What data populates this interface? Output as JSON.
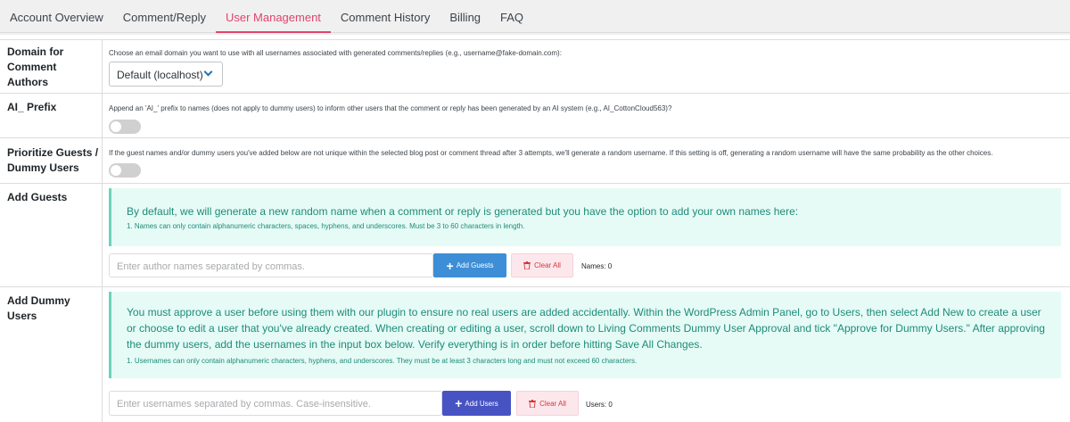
{
  "tabs": [
    {
      "label": "Account Overview",
      "active": false
    },
    {
      "label": "Comment/Reply",
      "active": false
    },
    {
      "label": "User Management",
      "active": true
    },
    {
      "label": "Comment History",
      "active": false
    },
    {
      "label": "Billing",
      "active": false
    },
    {
      "label": "FAQ",
      "active": false
    }
  ],
  "domain": {
    "label": "Domain for Comment Authors",
    "description": "Choose an email domain you want to use with all usernames associated with generated comments/replies (e.g., username@fake-domain.com):",
    "selected": "Default (localhost)"
  },
  "ai_prefix": {
    "label": "AI_ Prefix",
    "description": "Append an 'AI_' prefix to names (does not apply to dummy users) to inform other users that the comment or reply has been generated by an AI system (e.g., AI_CottonCloud563)?",
    "enabled": false
  },
  "prioritize": {
    "label": "Prioritize Guests / Dummy Users",
    "description": "If the guest names and/or dummy users you've added below are not unique within the selected blog post or comment thread after 3 attempts, we'll generate a random username. If this setting is off, generating a random username will have the same probability as the other choices.",
    "enabled": false
  },
  "guests": {
    "label": "Add Guests",
    "notice": "By default, we will generate a new random name when a comment or reply is generated but you have the option to add your own names here:",
    "note": "1. Names can only contain alphanumeric characters, spaces, hyphens, and underscores. Must be 3 to 60 characters in length.",
    "placeholder": "Enter author names separated by commas.",
    "add_label": "Add Guests",
    "clear_label": "Clear All",
    "count_text": "Names: 0"
  },
  "dummy": {
    "label": "Add Dummy Users",
    "notice": "You must approve a user before using them with our plugin to ensure no real users are added accidentally. Within the WordPress Admin Panel, go to Users, then select Add New to create a user or choose to edit a user that you've already created. When creating or editing a user, scroll down to Living Comments Dummy User Approval and tick \"Approve for Dummy Users.\" After approving the dummy users, add the usernames in the input box below. Verify everything is in order before hitting Save All Changes.",
    "note": "1. Usernames can only contain alphanumeric characters, hyphens, and underscores. They must be at least 3 characters long and must not exceed 60 characters.",
    "placeholder": "Enter usernames separated by commas. Case-insensitive.",
    "add_label": "Add Users",
    "clear_label": "Clear All",
    "count_text": "Users: 0"
  },
  "colors": {
    "accent": "#e0456b",
    "guest_button": "#3d8ed6",
    "user_button": "#4753c3",
    "notice_bg": "#e6fbf6",
    "notice_text": "#1e8b7a"
  }
}
